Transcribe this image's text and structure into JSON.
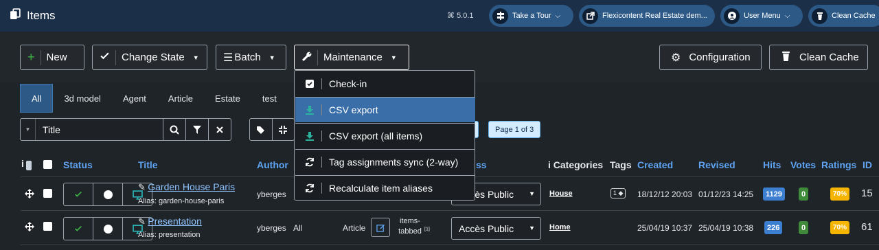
{
  "header": {
    "title": "Items",
    "version": "5.0.1",
    "pills": [
      {
        "label": "Take a Tour",
        "has_caret": true
      },
      {
        "label": "Flexicontent Real Estate dem...",
        "has_caret": false
      },
      {
        "label": "User Menu",
        "has_caret": true
      },
      {
        "label": "Clean Cache",
        "has_caret": false
      }
    ]
  },
  "toolbar": {
    "new_label": "New",
    "change_state_label": "Change State",
    "batch_label": "Batch",
    "maintenance_label": "Maintenance",
    "configuration_label": "Configuration",
    "clean_cache_label": "Clean Cache"
  },
  "maintenance_menu": {
    "items": [
      {
        "label": "Check-in",
        "icon": "checkbox-icon"
      },
      {
        "label": "CSV export",
        "icon": "download-icon"
      },
      {
        "label": "CSV export (all items)",
        "icon": "download-icon"
      },
      {
        "label": "Tag assignments sync (2-way)",
        "icon": "sync-icon"
      },
      {
        "label": "Recalculate item aliases",
        "icon": "sync-icon"
      }
    ],
    "highlighted_index": 1
  },
  "type_tabs": [
    "All",
    "3d model",
    "Agent",
    "Article",
    "Estate",
    "test"
  ],
  "filter": {
    "field_label": "Title"
  },
  "pagination": {
    "label": "Page 1 of 3"
  },
  "table": {
    "headers": {
      "status": "Status",
      "title": "Title",
      "author": "Author",
      "access": "ss",
      "categories": "Categories",
      "categories_icon": "i",
      "tags": "Tags",
      "created": "Created",
      "revised": "Revised",
      "hits": "Hits",
      "votes": "Votes",
      "ratings": "Ratings",
      "id": "ID"
    },
    "rows": [
      {
        "title": "Garden House Paris",
        "alias": "Alias: garden-house-paris",
        "author": "yberges",
        "access": "Accès Public",
        "category": "House",
        "tags_count": "1",
        "created": "18/12/12 20:03",
        "revised": "01/12/23 14:25",
        "hits": "1129",
        "votes": "0",
        "rating": "70%",
        "id": "15"
      },
      {
        "title": "Presentation",
        "alias": "Alias: presentation",
        "author": "yberges",
        "language": "All",
        "type": "Article",
        "layout": "items-tabbed",
        "layout_sup": "[1]",
        "access": "Accès Public",
        "category": "Home",
        "created": "25/04/19 10:37",
        "revised": "25/04/19 10:38",
        "hits": "226",
        "votes": "0",
        "rating": "70%",
        "id": "61"
      }
    ]
  }
}
